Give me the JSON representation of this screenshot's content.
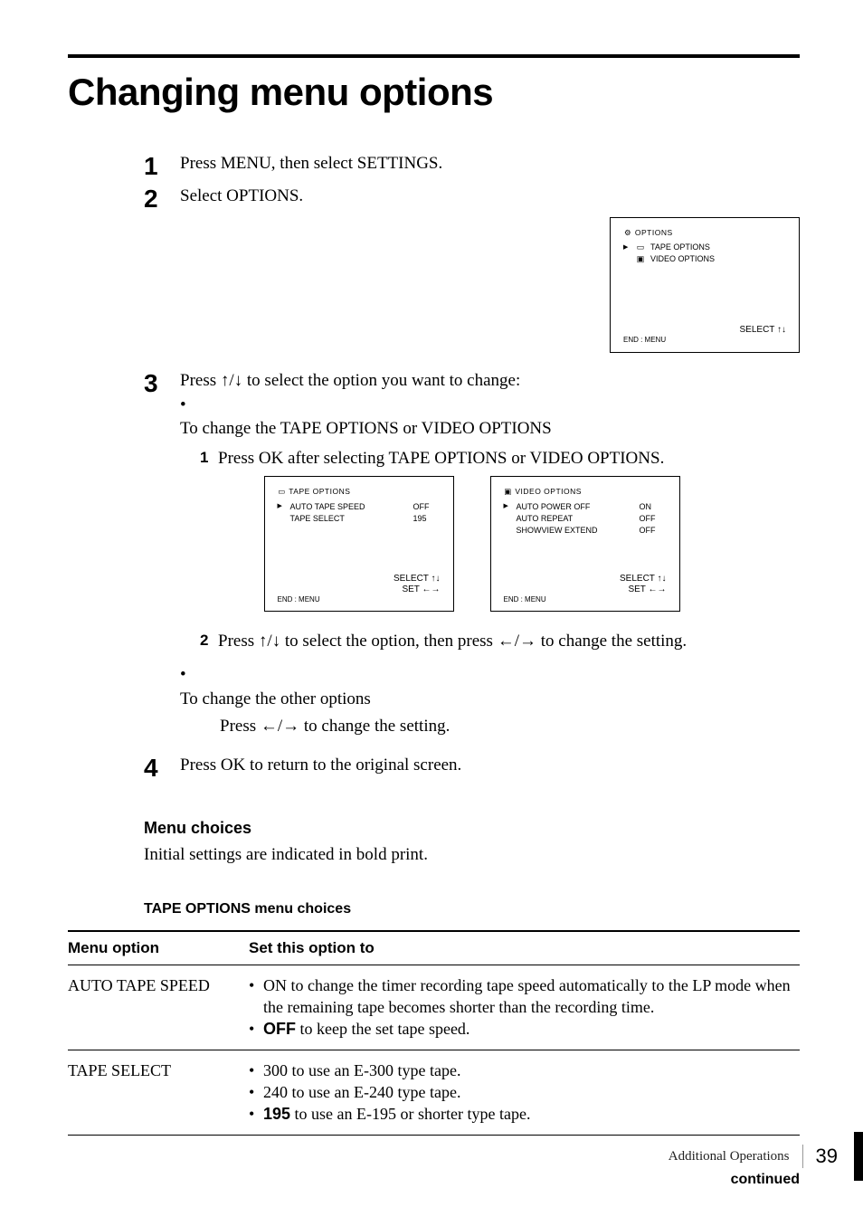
{
  "title": "Changing menu options",
  "steps": {
    "s1": "Press MENU, then select SETTINGS.",
    "s2": "Select OPTIONS.",
    "s3": "Press ↑/↓ to select the option you want to change:",
    "s3_b1": "To change the TAPE OPTIONS or VIDEO OPTIONS",
    "s3_sub1": "Press OK after selecting TAPE OPTIONS or VIDEO OPTIONS.",
    "s3_sub2": "Press ↑/↓ to select the option, then press ←/→ to change the setting.",
    "s3_b2": "To change the other options",
    "s3_b2_body": "Press ←/→ to change the setting.",
    "s4": "Press OK to return to the original screen."
  },
  "menu_choices_heading": "Menu choices",
  "menu_choices_text": "Initial settings are indicated in bold print.",
  "table_title": "TAPE OPTIONS menu choices",
  "table_headers": [
    "Menu option",
    "Set this option to"
  ],
  "rows": [
    {
      "name": "AUTO TAPE SPEED",
      "opts": [
        {
          "pre": "ON",
          "rest": " to change the timer recording tape speed automatically to the LP mode when the remaining tape becomes shorter than the recording time."
        },
        {
          "bold": "OFF",
          "rest": " to keep the set tape speed."
        }
      ]
    },
    {
      "name": "TAPE SELECT",
      "opts": [
        {
          "pre": "300",
          "rest": " to use an E-300 type tape."
        },
        {
          "pre": "240",
          "rest": " to use an E-240 type tape."
        },
        {
          "bold": "195",
          "rest": " to use an E-195 or shorter type tape."
        }
      ]
    }
  ],
  "continued": "continued",
  "footer_section": "Additional Operations",
  "footer_page": "39",
  "screens": {
    "options": {
      "header": "OPTIONS",
      "rows": [
        {
          "label": "TAPE OPTIONS",
          "ptr": true
        },
        {
          "label": "VIDEO OPTIONS",
          "ptr": false
        }
      ],
      "foot_select": "SELECT ↑↓",
      "foot_end": "END : MENU"
    },
    "tape": {
      "header": "TAPE OPTIONS",
      "rows": [
        {
          "label": "AUTO TAPE SPEED",
          "val": "OFF",
          "ptr": true
        },
        {
          "label": "TAPE SELECT",
          "val": "195",
          "ptr": false
        }
      ],
      "foot_select": "SELECT ↑↓",
      "foot_set": "SET      ←→",
      "foot_end": "END : MENU"
    },
    "video": {
      "header": "VIDEO OPTIONS",
      "rows": [
        {
          "label": "AUTO POWER OFF",
          "val": "ON",
          "ptr": true
        },
        {
          "label": "AUTO REPEAT",
          "val": "OFF",
          "ptr": false
        },
        {
          "label": "SHOWVIEW EXTEND",
          "val": "OFF",
          "ptr": false
        }
      ],
      "foot_select": "SELECT ↑↓",
      "foot_set": "SET      ←→",
      "foot_end": "END : MENU"
    }
  },
  "icons": {
    "cassette": "▭",
    "tv": "▣"
  }
}
